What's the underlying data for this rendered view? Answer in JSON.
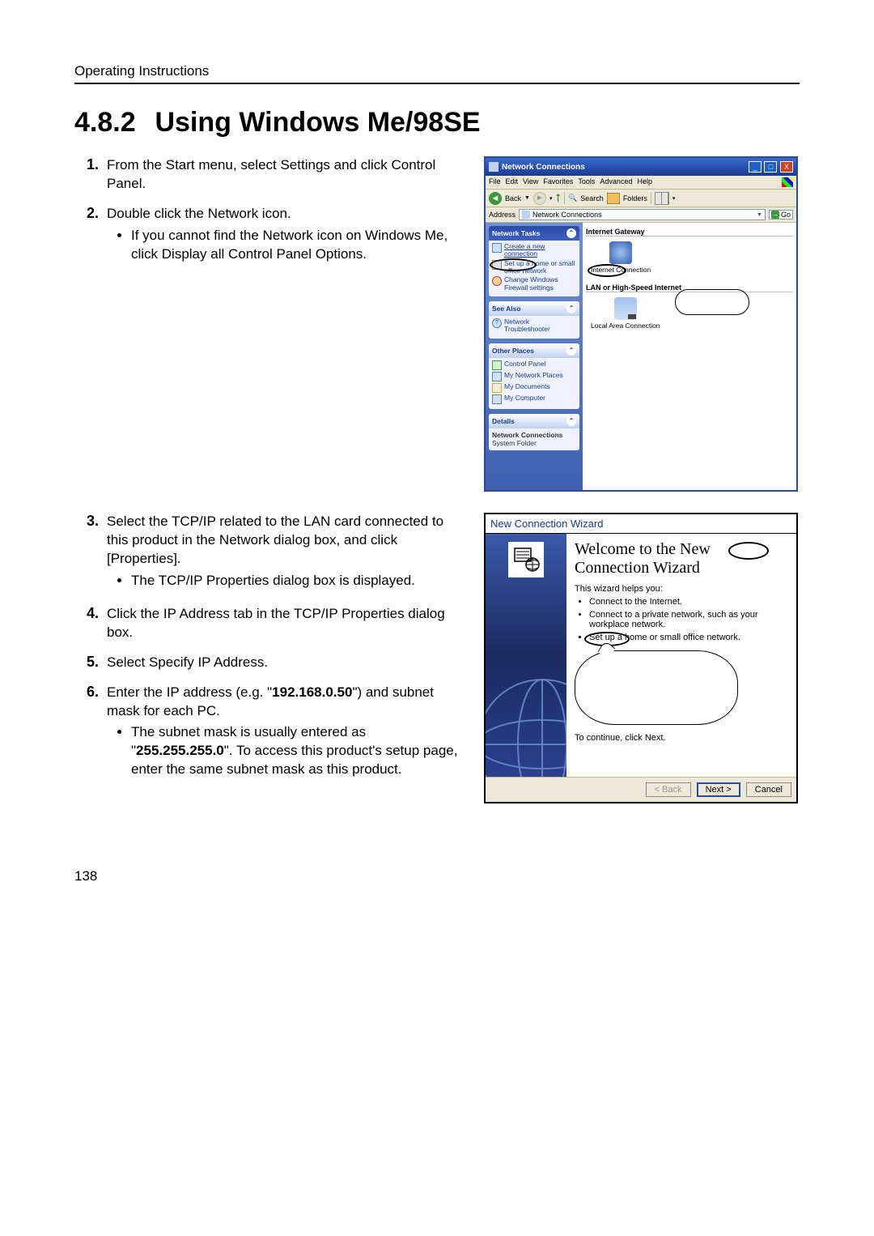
{
  "header": "Operating Instructions",
  "section_number": "4.8.2",
  "section_title": "Using Windows Me/98SE",
  "page_number": "138",
  "steps_block1": [
    {
      "n": "1.",
      "text": "From the Start menu, select Settings and click Control Panel.",
      "bullets": []
    },
    {
      "n": "2.",
      "text": "Double click the Network icon.",
      "bullets": [
        "If you cannot find the Network icon on Windows Me, click Display all Control Panel Options."
      ]
    }
  ],
  "steps_block2": [
    {
      "n": "3.",
      "text": "Select the TCP/IP related to the LAN card connected to this product in the Network dialog box, and click [Properties].",
      "bullets": [
        "The TCP/IP Properties dialog box is displayed."
      ]
    },
    {
      "n": "4.",
      "text": "Click the IP Address tab in the TCP/IP Properties dialog box.",
      "bullets": []
    },
    {
      "n": "5.",
      "text": "Select Specify IP Address.",
      "bullets": []
    }
  ],
  "steps_block2_partB": {
    "n": "6.",
    "text_before": "Enter the IP address (e.g. \"",
    "ip": "192.168.0.50",
    "text_mid": "\") and subnet mask for each PC.",
    "bullet_before": "The subnet mask is usually entered as \"",
    "mask": "255.255.255.0",
    "bullet_after": "\". To access this product's setup page, enter the same subnet mask as this product."
  },
  "shot1": {
    "title": "Network Connections",
    "menu": {
      "file": "File",
      "edit": "Edit",
      "view": "View",
      "favorites": "Favorites",
      "tools": "Tools",
      "advanced": "Advanced",
      "help": "Help"
    },
    "toolbar": {
      "back": "Back",
      "search": "Search",
      "folders": "Folders"
    },
    "address_label": "Address",
    "address_value": "Network Connections",
    "go": "Go",
    "panels": {
      "tasks": {
        "header": "Network Tasks",
        "items": [
          "Create a new connection",
          "Set up a home or small office network",
          "Change Windows Firewall settings"
        ]
      },
      "seealso": {
        "header": "See Also",
        "items": [
          "Network Troubleshooter"
        ]
      },
      "other": {
        "header": "Other Places",
        "items": [
          "Control Panel",
          "My Network Places",
          "My Documents",
          "My Computer"
        ]
      },
      "details": {
        "header": "Details",
        "line1": "Network Connections",
        "line2": "System Folder"
      }
    },
    "content": {
      "group1": "Internet Gateway",
      "item1": "Internet Connection",
      "group2": "LAN or High-Speed Internet",
      "item2": "Local Area Connection"
    }
  },
  "shot2": {
    "title": "New Connection Wizard",
    "heading": "Welcome to the New Connection Wizard",
    "intro": "This wizard helps you:",
    "bullets": [
      "Connect to the Internet.",
      "Connect to a private network, such as your workplace network.",
      "Set up a home or small office network."
    ],
    "continue": "To continue, click Next.",
    "buttons": {
      "back": "< Back",
      "next": "Next >",
      "cancel": "Cancel"
    }
  }
}
